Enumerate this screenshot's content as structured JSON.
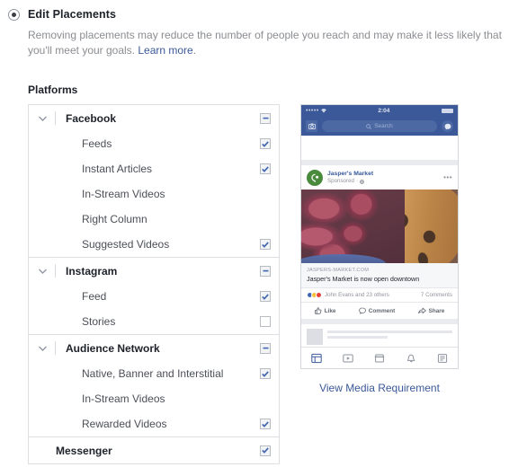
{
  "header": {
    "radio_label": "Edit Placements",
    "radio_selected": true,
    "description_text": "Removing placements may reduce the number of people you reach and may make it less likely that you'll meet your goals.",
    "learn_more_label": "Learn more",
    "description_suffix": "."
  },
  "platforms_label": "Platforms",
  "colors": {
    "accent_blue": "#3b5998",
    "link_blue": "#3b5998",
    "checkbox_blue": "#4267b2",
    "border_gray": "#dddfe2",
    "muted_text": "#8a8d91"
  },
  "placements": {
    "groups": [
      {
        "name": "Facebook",
        "state": "indeterminate",
        "expanded": true,
        "chevron": "chevron-down-icon",
        "children": [
          {
            "name": "Feeds",
            "state": "checked"
          },
          {
            "name": "Instant Articles",
            "state": "checked"
          },
          {
            "name": "In-Stream Videos",
            "state": "none"
          },
          {
            "name": "Right Column",
            "state": "none"
          },
          {
            "name": "Suggested Videos",
            "state": "checked"
          }
        ]
      },
      {
        "name": "Instagram",
        "state": "indeterminate",
        "expanded": true,
        "chevron": "chevron-down-icon",
        "children": [
          {
            "name": "Feed",
            "state": "checked"
          },
          {
            "name": "Stories",
            "state": "unchecked"
          }
        ]
      },
      {
        "name": "Audience Network",
        "state": "indeterminate",
        "expanded": true,
        "chevron": "chevron-down-icon",
        "children": [
          {
            "name": "Native, Banner and Interstitial",
            "state": "checked"
          },
          {
            "name": "In-Stream Videos",
            "state": "none"
          },
          {
            "name": "Rewarded Videos",
            "state": "checked"
          }
        ]
      },
      {
        "name": "Messenger",
        "state": "checked",
        "expanded": false,
        "chevron": "none",
        "children": []
      }
    ]
  },
  "preview": {
    "status_bar": {
      "signal": "•••••",
      "wifi_icon": "wifi-icon",
      "time": "2:04",
      "battery_icon": "battery-icon"
    },
    "nav": {
      "camera_icon": "camera-icon",
      "search_icon": "search-icon",
      "search_placeholder": "Search",
      "messenger_icon": "messenger-icon"
    },
    "post": {
      "page_name": "Jasper's Market",
      "meta": "Sponsored",
      "meta_globe_icon": "globe-icon",
      "meta_separator": "·",
      "more_icon": "ellipsis-icon",
      "image_alt": "figs-and-bread-photo",
      "link_host": "JASPERS-MARKET.COM",
      "link_title": "Jasper's Market is now open downtown",
      "reactions_text": "John Evans and 23 others",
      "comment_count": "7 Comments",
      "actions": [
        {
          "label": "Like",
          "icon": "thumbs-up-icon"
        },
        {
          "label": "Comment",
          "icon": "comment-bubble-icon"
        },
        {
          "label": "Share",
          "icon": "share-arrow-icon"
        }
      ]
    },
    "tabbar": [
      {
        "icon": "news-feed-icon",
        "active": true
      },
      {
        "icon": "video-icon",
        "active": false
      },
      {
        "icon": "marketplace-icon",
        "active": false
      },
      {
        "icon": "notifications-bell-icon",
        "active": false
      },
      {
        "icon": "menu-list-icon",
        "active": false
      }
    ],
    "media_requirement_link": "View Media Requirement"
  }
}
